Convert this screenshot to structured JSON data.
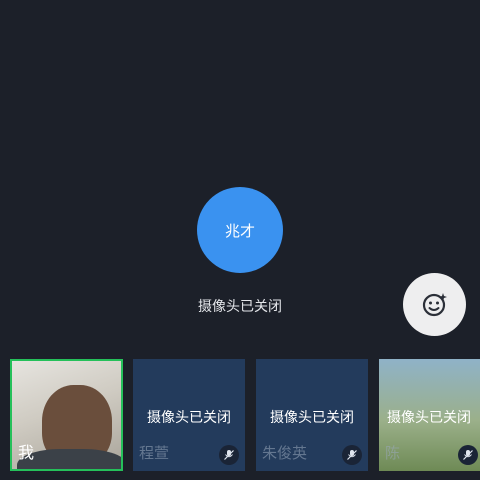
{
  "main": {
    "avatar_text": "兆才",
    "status": "摄像头已关闭"
  },
  "emoji_button": {
    "icon": "smiley-icon"
  },
  "tiles": [
    {
      "name": "我",
      "status": "",
      "muted": false,
      "selected": true
    },
    {
      "name": "程萱",
      "status": "摄像头已关闭",
      "muted": true
    },
    {
      "name": "朱俊英",
      "status": "摄像头已关闭",
      "muted": true
    },
    {
      "name": "陈",
      "status": "摄像头已关闭",
      "muted": true
    }
  ],
  "colors": {
    "background": "#1c2029",
    "avatar": "#3a92f0",
    "selected_border": "#25c05a",
    "tile": "#233b5c"
  }
}
